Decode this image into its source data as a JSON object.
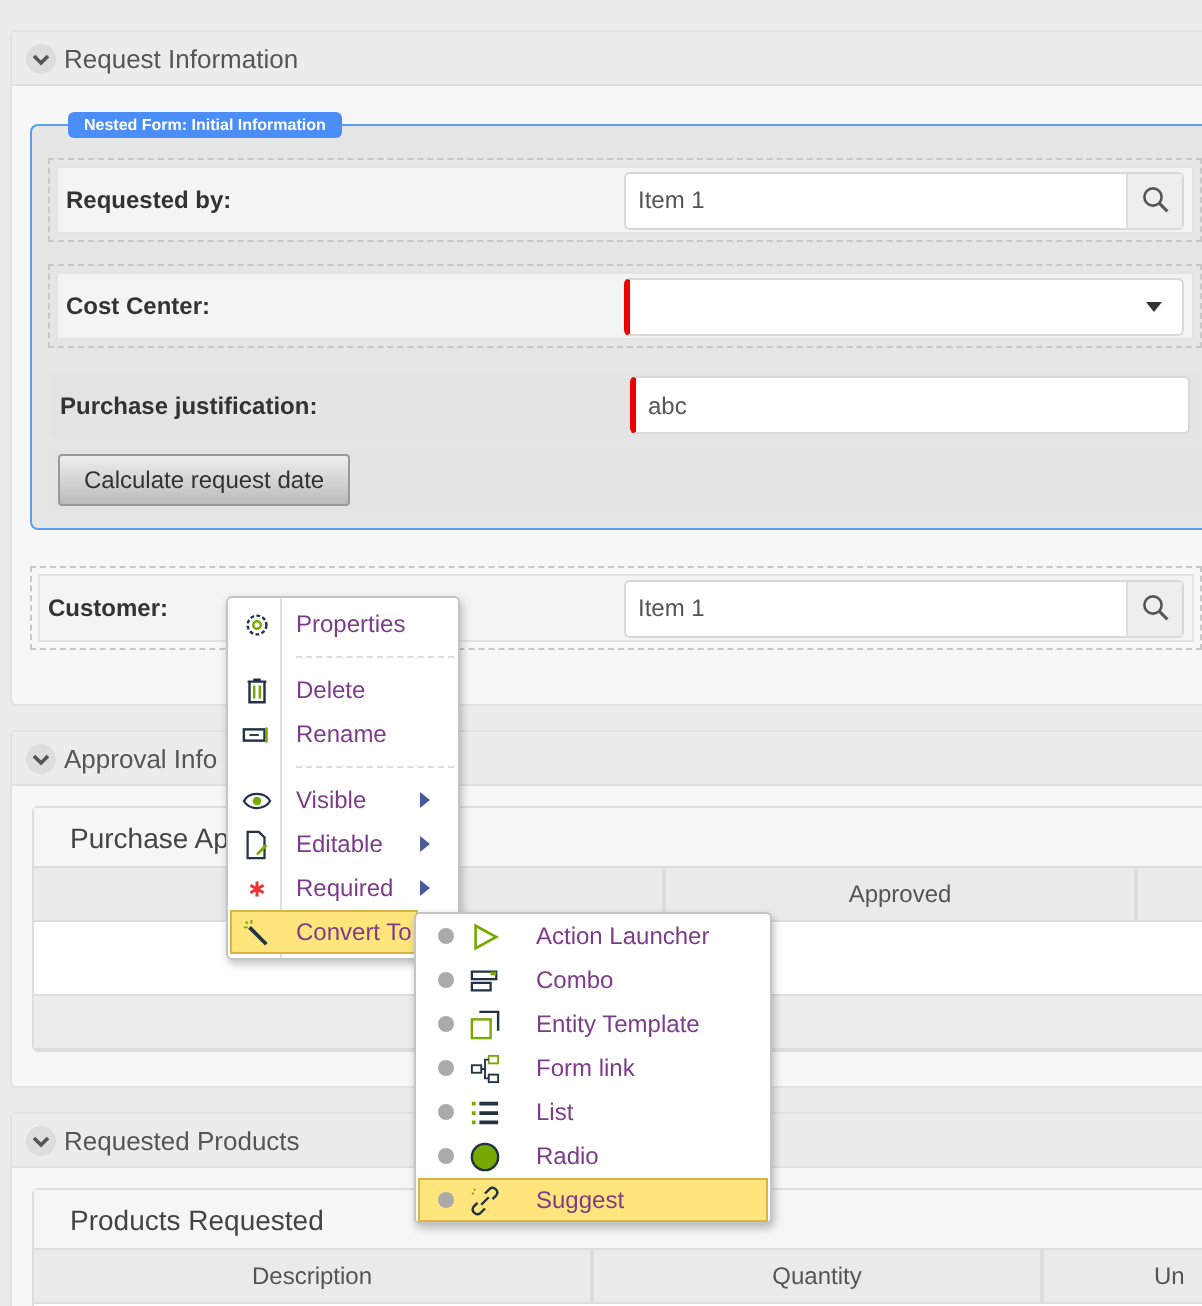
{
  "sections": [
    {
      "title": "Request Information",
      "expanded": true,
      "nested_form": {
        "label": "Nested Form: Initial Information",
        "fields": [
          {
            "kind": "lookup",
            "label": "Requested by:",
            "value": "Item 1",
            "required": false,
            "framed": true
          },
          {
            "kind": "combo",
            "label": "Cost Center:",
            "required": true,
            "framed": true
          },
          {
            "kind": "text",
            "label": "Purchase justification:",
            "value": "abc",
            "required": true,
            "framed": false
          }
        ],
        "button": "Calculate request date"
      },
      "fields": [
        {
          "kind": "lookup",
          "label": "Customer:",
          "value": "Item 1",
          "required": false,
          "framed": true
        }
      ]
    },
    {
      "title": "Approval Info",
      "expanded": true,
      "table": {
        "title": "Purchase Ap",
        "columns": [
          {
            "label": "Approved"
          }
        ]
      }
    },
    {
      "title": "Requested Products",
      "expanded": true,
      "table": {
        "title": "Products Requested",
        "columns": [
          {
            "label": "Description"
          },
          {
            "label": "Quantity"
          },
          {
            "label": "Un"
          }
        ]
      }
    }
  ],
  "context_menu": {
    "items": [
      {
        "kind": "item",
        "label": "Properties",
        "has_submenu": false,
        "selected": false
      },
      {
        "kind": "separator"
      },
      {
        "kind": "item",
        "label": "Delete",
        "has_submenu": false,
        "selected": false
      },
      {
        "kind": "item",
        "label": "Rename",
        "has_submenu": false,
        "selected": false
      },
      {
        "kind": "separator"
      },
      {
        "kind": "item",
        "label": "Visible",
        "has_submenu": true,
        "selected": false
      },
      {
        "kind": "item",
        "label": "Editable",
        "has_submenu": true,
        "selected": false
      },
      {
        "kind": "item",
        "label": "Required",
        "has_submenu": true,
        "selected": false
      },
      {
        "kind": "item",
        "label": "Convert To",
        "has_submenu": true,
        "selected": true
      }
    ]
  },
  "submenu": {
    "items": [
      {
        "label": "Action Launcher",
        "selected": false
      },
      {
        "label": "Combo",
        "selected": false
      },
      {
        "label": "Entity Template",
        "selected": false
      },
      {
        "label": "Form link",
        "selected": false
      },
      {
        "label": "List",
        "selected": false
      },
      {
        "label": "Radio",
        "selected": false
      },
      {
        "label": "Suggest",
        "selected": true
      }
    ]
  }
}
